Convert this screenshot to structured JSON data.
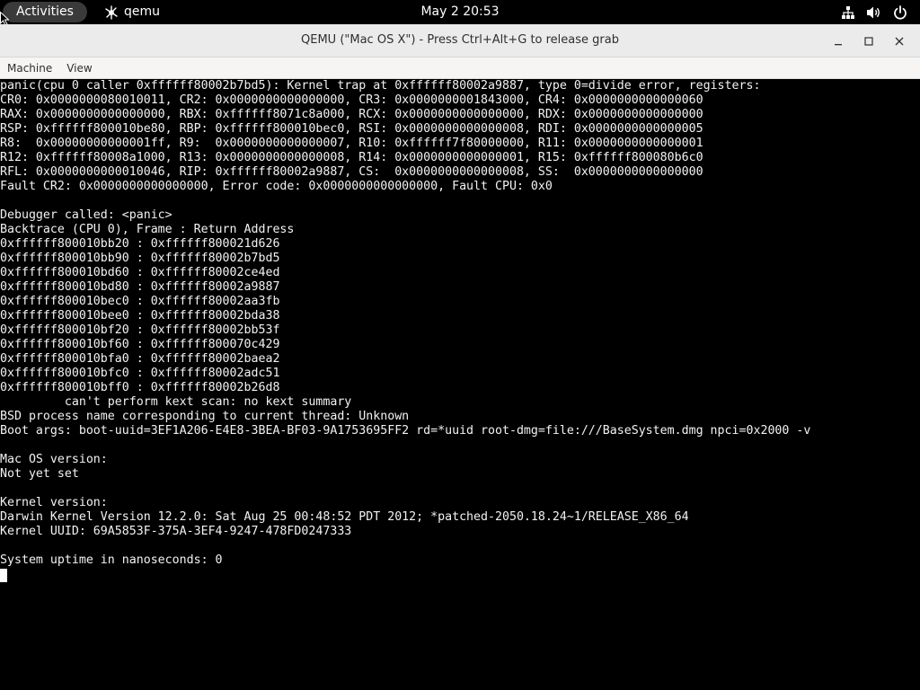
{
  "topbar": {
    "activities_label": "Activities",
    "app_name": "qemu",
    "clock": "May 2  20:53"
  },
  "window": {
    "title": "QEMU (\"Mac OS X\") - Press Ctrl+Alt+G to release grab"
  },
  "menubar": {
    "items": [
      "Machine",
      "View"
    ]
  },
  "console": {
    "lines": [
      "panic(cpu 0 caller 0xffffff80002b7bd5): Kernel trap at 0xffffff80002a9887, type 0=divide error, registers:",
      "CR0: 0x0000000080010011, CR2: 0x0000000000000000, CR3: 0x0000000001843000, CR4: 0x0000000000000060",
      "RAX: 0x0000000000000000, RBX: 0xffffff8071c8a000, RCX: 0x0000000000000000, RDX: 0x0000000000000000",
      "RSP: 0xffffff800010be80, RBP: 0xffffff800010bec0, RSI: 0x0000000000000008, RDI: 0x0000000000000005",
      "R8:  0x00000000000001ff, R9:  0x0000000000000007, R10: 0xffffff7f80000000, R11: 0x0000000000000001",
      "R12: 0xffffff80008a1000, R13: 0x0000000000000008, R14: 0x0000000000000001, R15: 0xffffff800080b6c0",
      "RFL: 0x0000000000010046, RIP: 0xffffff80002a9887, CS:  0x0000000000000008, SS:  0x0000000000000000",
      "Fault CR2: 0x0000000000000000, Error code: 0x0000000000000000, Fault CPU: 0x0",
      "",
      "Debugger called: <panic>",
      "Backtrace (CPU 0), Frame : Return Address",
      "0xffffff800010bb20 : 0xffffff800021d626",
      "0xffffff800010bb90 : 0xffffff80002b7bd5",
      "0xffffff800010bd60 : 0xffffff80002ce4ed",
      "0xffffff800010bd80 : 0xffffff80002a9887",
      "0xffffff800010bec0 : 0xffffff80002aa3fb",
      "0xffffff800010bee0 : 0xffffff80002bda38",
      "0xffffff800010bf20 : 0xffffff80002bb53f",
      "0xffffff800010bf60 : 0xffffff800070c429",
      "0xffffff800010bfa0 : 0xffffff80002baea2",
      "0xffffff800010bfc0 : 0xffffff80002adc51",
      "0xffffff800010bff0 : 0xffffff80002b26d8",
      "         can't perform kext scan: no kext summary",
      "BSD process name corresponding to current thread: Unknown",
      "Boot args: boot-uuid=3EF1A206-E4E8-3BEA-BF03-9A1753695FF2 rd=*uuid root-dmg=file:///BaseSystem.dmg npci=0x2000 -v",
      "",
      "Mac OS version:",
      "Not yet set",
      "",
      "Kernel version:",
      "Darwin Kernel Version 12.2.0: Sat Aug 25 00:48:52 PDT 2012; *patched-2050.18.24~1/RELEASE_X86_64",
      "Kernel UUID: 69A5853F-375A-3EF4-9247-478FD0247333",
      "",
      "System uptime in nanoseconds: 0"
    ]
  },
  "icons": {
    "app": "qemu-app-icon",
    "network": "network-wired-icon",
    "volume": "speaker-volume-icon",
    "power": "power-icon",
    "minimize": "minimize-icon",
    "maximize": "maximize-icon",
    "close": "close-icon",
    "pointer": "mouse-pointer-icon"
  }
}
